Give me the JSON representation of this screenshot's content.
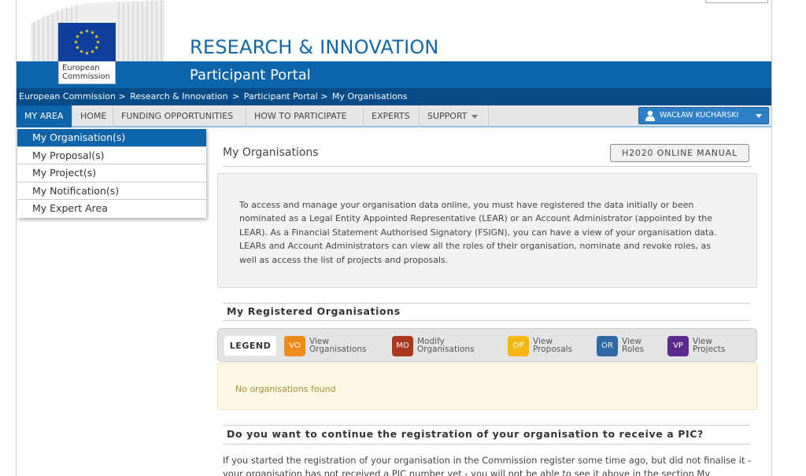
{
  "header": {
    "logo_line1": "European",
    "logo_line2": "Commission",
    "site_title": "RESEARCH & INNOVATION",
    "portal_title": "Participant Portal"
  },
  "breadcrumb": {
    "items": [
      "European Commission >",
      "Research & Innovation",
      ">",
      "Participant Portal >",
      "My Organisations"
    ]
  },
  "nav": {
    "items": [
      "MY AREA",
      "HOME",
      "FUNDING OPPORTUNITIES",
      "HOW TO PARTICIPATE",
      "EXPERTS",
      "SUPPORT"
    ],
    "user": "WACŁAW KUCHARSKI"
  },
  "dropdown": {
    "items": [
      "My Organisation(s)",
      "My Proposal(s)",
      "My Project(s)",
      "My Notification(s)",
      "My Expert Area"
    ]
  },
  "main": {
    "title": "My Organisations",
    "manual_button": "H2020 ONLINE MANUAL",
    "info_lines": [
      "To access and manage your organisation data online, you must have registered the data initially or been",
      "nominated as a Legal Entity Appointed Representative (LEAR) or an Account Administrator (appointed by the",
      "LEAR). As a Financial Statement Authorised Signatory (FSIGN), you can have a view of your organisation data.",
      "LEARs and Account Administrators can view all the roles of their organisation, nominate and revoke roles, as",
      "well as access the list of projects and proposals."
    ],
    "registered_title": "My Registered Organisations",
    "legend_label": "LEGEND",
    "legend": [
      {
        "code": "VO",
        "line1": "View",
        "line2": "Organisations",
        "color": "#f08c1c"
      },
      {
        "code": "MO",
        "line1": "Modify",
        "line2": "Organisations",
        "color": "#a9381e"
      },
      {
        "code": "OP",
        "line1": "View",
        "line2": "Proposals",
        "color": "#f6b614"
      },
      {
        "code": "OR",
        "line1": "View",
        "line2": "Roles",
        "color": "#2e6aa6"
      },
      {
        "code": "VP",
        "line1": "View",
        "line2": "Projects",
        "color": "#5a2a8c"
      }
    ],
    "no_orgs": "No organisations found",
    "continue_title": "Do you want to continue the registration of your organisation to receive a PIC?",
    "bottom_lines": [
      "If you started the registration of your organisation in the Commission register some time ago, but did not finalise it -",
      "your organisation has not received a PIC number yet - you will not be able to see it above in the section My"
    ]
  },
  "colors": {
    "brand_blue": "#0d64a9",
    "crumb_blue": "#064c8a",
    "title_blue": "#0f68aa",
    "eu_blue": "#0e3f9e",
    "eu_star": "#ffdd00"
  }
}
